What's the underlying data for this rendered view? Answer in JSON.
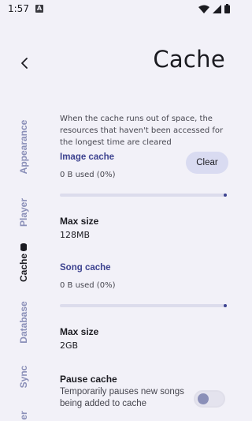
{
  "status_bar": {
    "time": "1:57",
    "notification_badge": "A"
  },
  "header": {
    "title": "Cache",
    "back_icon": "back-arrow-icon"
  },
  "side_nav": {
    "tabs": [
      {
        "label": "Appearance",
        "active": false
      },
      {
        "label": "Player",
        "active": false
      },
      {
        "label": "Cache",
        "active": true,
        "icon": "storage-icon"
      },
      {
        "label": "Database",
        "active": false
      },
      {
        "label": "Sync",
        "active": false
      },
      {
        "label": "er",
        "active": false
      }
    ]
  },
  "description": "When the cache runs out of space, the resources that haven't been accessed for the longest time are cleared",
  "image_cache": {
    "title": "Image cache",
    "usage": "0 B used (0%)",
    "usage_fraction": 0,
    "clear_label": "Clear",
    "max_size_label": "Max size",
    "max_size_value": "128MB"
  },
  "song_cache": {
    "title": "Song cache",
    "usage": "0 B used (0%)",
    "usage_fraction": 0,
    "max_size_label": "Max size",
    "max_size_value": "2GB"
  },
  "pause_cache": {
    "title": "Pause cache",
    "description": "Temporarily pauses new songs being added to cache",
    "enabled": false
  },
  "colors": {
    "accent": "#3d4390",
    "background": "#f2f1f8",
    "inactive_tab": "#8a8fb8"
  }
}
